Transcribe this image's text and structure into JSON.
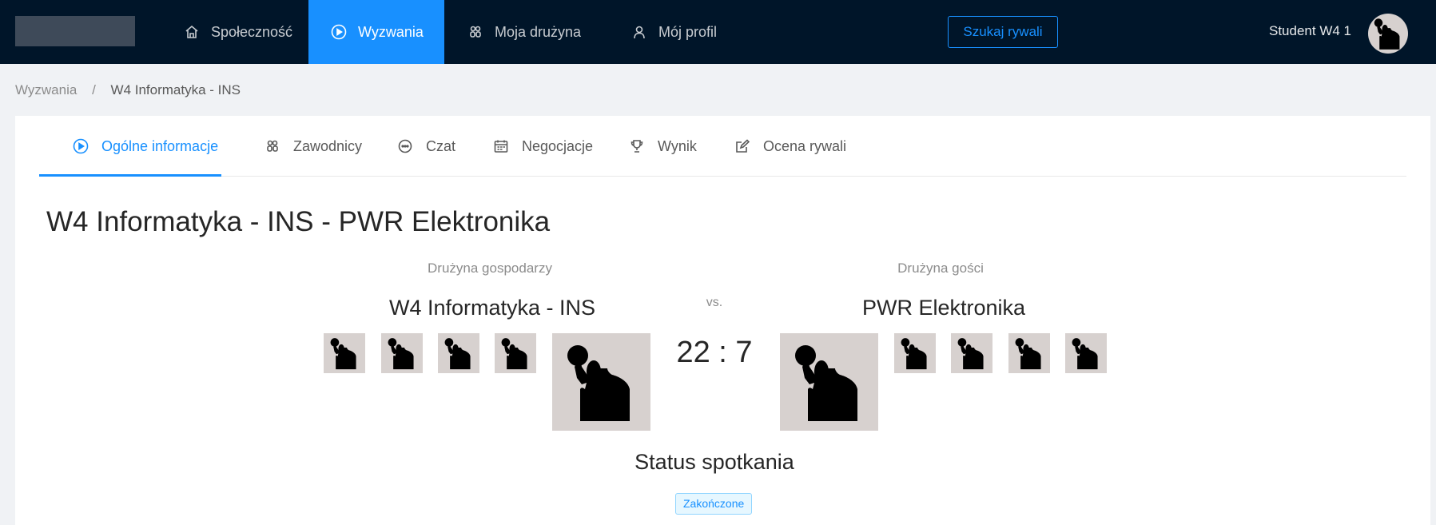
{
  "header": {
    "nav": [
      {
        "label": "Społeczność",
        "icon": "home-icon"
      },
      {
        "label": "Wyzwania",
        "icon": "play-circle-icon",
        "active": true
      },
      {
        "label": "Moja drużyna",
        "icon": "team-icon"
      },
      {
        "label": "Mój profil",
        "icon": "user-icon"
      }
    ],
    "search_button": "Szukaj rywali",
    "user_name": "Student W4 1"
  },
  "breadcrumb": {
    "root": "Wyzwania",
    "separator": "/",
    "current": "W4 Informatyka - INS"
  },
  "tabs": [
    {
      "label": "Ogólne informacje",
      "icon": "play-circle-icon",
      "active": true
    },
    {
      "label": "Zawodnicy",
      "icon": "team-icon"
    },
    {
      "label": "Czat",
      "icon": "message-icon"
    },
    {
      "label": "Negocjacje",
      "icon": "calendar-icon"
    },
    {
      "label": "Wynik",
      "icon": "trophy-icon"
    },
    {
      "label": "Ocena rywali",
      "icon": "edit-icon"
    }
  ],
  "match": {
    "title": "W4 Informatyka - INS - PWR Elektronika",
    "home_label": "Drużyna gospodarzy",
    "away_label": "Drużyna gości",
    "home_team": "W4 Informatyka - INS",
    "away_team": "PWR Elektronika",
    "vs": "vs.",
    "score": "22 : 7",
    "status_title": "Status spotkania",
    "status": "Zakończone"
  },
  "colors": {
    "header_bg": "#001529",
    "accent": "#1890ff",
    "avatar_bg": "#d7d1cf"
  }
}
